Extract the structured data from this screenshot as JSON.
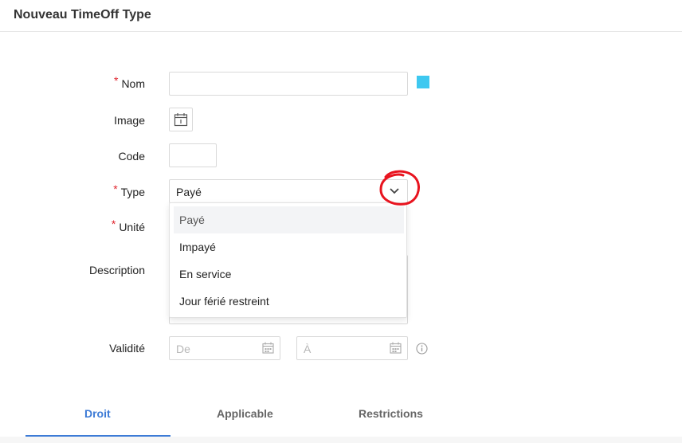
{
  "header": {
    "title": "Nouveau TimeOff Type"
  },
  "form": {
    "required_mark": "*",
    "nom": {
      "label": "Nom",
      "value": "",
      "color": "#3ec8f0"
    },
    "image": {
      "label": "Image",
      "icon": "calendar-icon"
    },
    "code": {
      "label": "Code",
      "value": ""
    },
    "type": {
      "label": "Type",
      "value": "Payé",
      "options": [
        "Payé",
        "Impayé",
        "En service",
        "Jour férié restreint"
      ]
    },
    "unite": {
      "label": "Unité"
    },
    "description": {
      "label": "Description",
      "value": ""
    },
    "validite": {
      "label": "Validité",
      "from_placeholder": "De",
      "to_placeholder": "À"
    }
  },
  "tabs": [
    {
      "label": "Droit",
      "active": true
    },
    {
      "label": "Applicable",
      "active": false
    },
    {
      "label": "Restrictions",
      "active": false
    }
  ],
  "colors": {
    "accent": "#3d7bd6",
    "required": "#e0262f",
    "annotation": "#e8141f"
  }
}
